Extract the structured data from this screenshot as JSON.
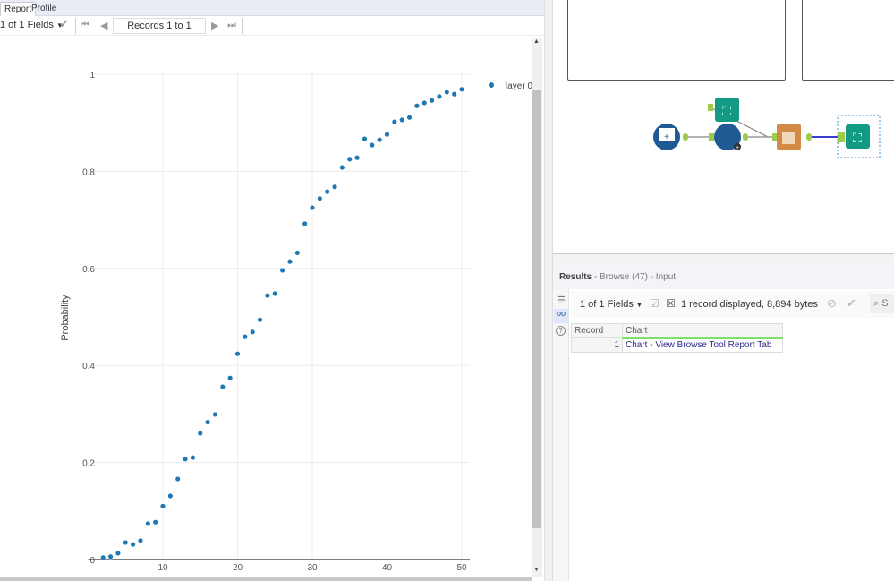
{
  "left_panel": {
    "tabs": [
      {
        "label": "Report"
      },
      {
        "label": "Profile"
      }
    ],
    "toolbar": {
      "fields": "1 of 1 Fields",
      "records": "Records 1 to 1"
    }
  },
  "chart_data": {
    "type": "scatter",
    "title": "",
    "xlabel": "",
    "ylabel": "Probability",
    "xlim": [
      0,
      52
    ],
    "ylim": [
      0,
      1
    ],
    "xticks": [
      "10",
      "20",
      "30",
      "40",
      "50"
    ],
    "yticks": [
      "0",
      "0.2",
      "0.4",
      "0.6",
      "0.8",
      "1"
    ],
    "grid": true,
    "legend": {
      "placement": "top-right",
      "entries": [
        "layer 0"
      ]
    },
    "series": [
      {
        "name": "layer 0",
        "color": "#1f77b4",
        "x": [
          2,
          3,
          4,
          5,
          6,
          7,
          8,
          9,
          10,
          11,
          12,
          13,
          14,
          15,
          16,
          17,
          18,
          19,
          20,
          21,
          22,
          23,
          24,
          25,
          26,
          27,
          28,
          29,
          30,
          31,
          32,
          33,
          34,
          35,
          36,
          37,
          38,
          39,
          40,
          41,
          42,
          43,
          44,
          45,
          46,
          47,
          48,
          49,
          50
        ],
        "y": [
          0.004,
          0.006,
          0.013,
          0.035,
          0.031,
          0.039,
          0.074,
          0.077,
          0.11,
          0.131,
          0.166,
          0.207,
          0.21,
          0.26,
          0.283,
          0.299,
          0.356,
          0.374,
          0.424,
          0.459,
          0.469,
          0.494,
          0.544,
          0.548,
          0.596,
          0.614,
          0.632,
          0.692,
          0.725,
          0.744,
          0.758,
          0.768,
          0.808,
          0.825,
          0.828,
          0.867,
          0.854,
          0.865,
          0.876,
          0.902,
          0.906,
          0.911,
          0.935,
          0.941,
          0.946,
          0.954,
          0.963,
          0.959,
          0.969
        ]
      }
    ]
  },
  "results": {
    "title": "Results",
    "subtitle": "- Browse (47) - Input",
    "fields": "1 of 1 Fields",
    "summary": "1 record displayed, 8,894 bytes",
    "search_placeholder": "S",
    "columns": [
      "Record",
      "Chart"
    ],
    "rows": [
      {
        "record": "1",
        "chart": "Chart - View Browse Tool Report Tab"
      }
    ]
  }
}
